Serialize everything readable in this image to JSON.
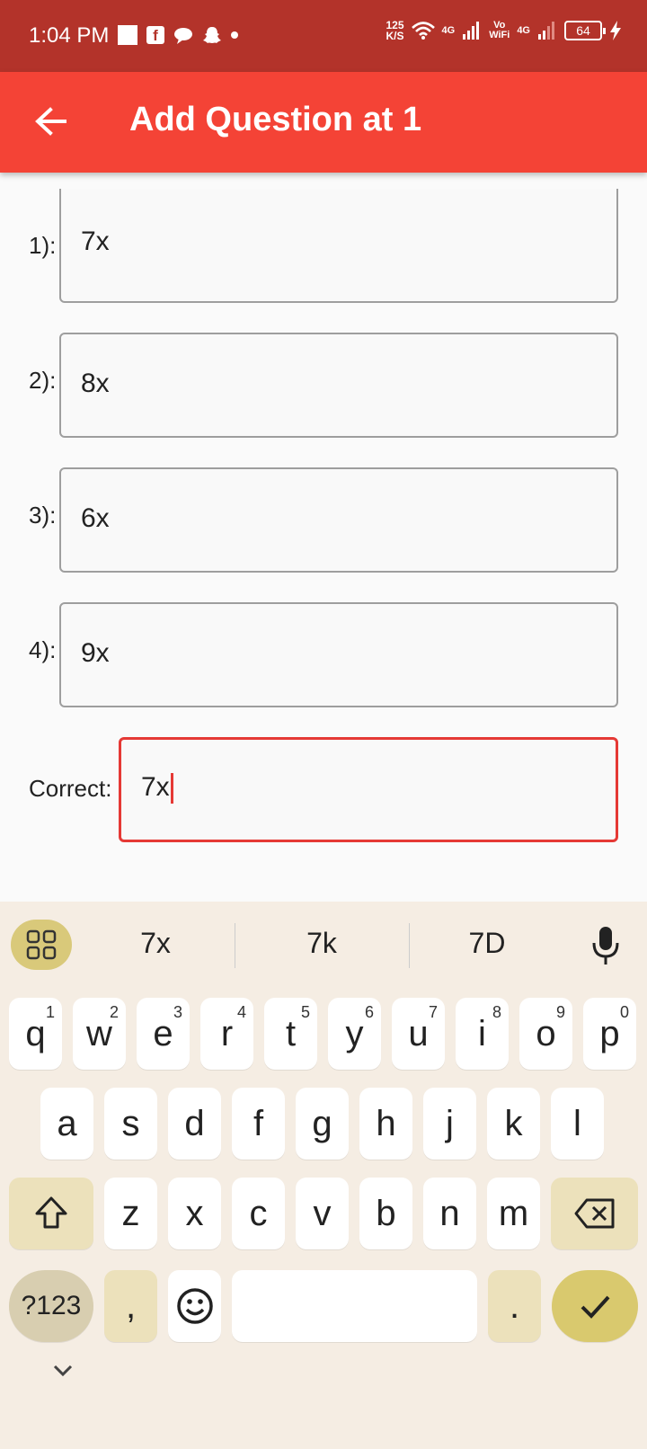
{
  "status_bar": {
    "time": "1:04 PM",
    "speed_value": "125",
    "speed_unit": "K/S",
    "network1": "4G",
    "volte_top": "Vo",
    "volte_bottom": "WiFi",
    "network2": "4G",
    "battery": "64"
  },
  "app_bar": {
    "title": "Add Question at 1"
  },
  "options": [
    {
      "label": "1):",
      "value": "7x"
    },
    {
      "label": "2):",
      "value": "8x"
    },
    {
      "label": "3):",
      "value": "6x"
    },
    {
      "label": "4):",
      "value": "9x"
    }
  ],
  "correct": {
    "label": "Correct:",
    "value": "7x"
  },
  "keyboard": {
    "suggestions": [
      "7x",
      "7k",
      "7D"
    ],
    "row1": [
      {
        "key": "q",
        "hint": "1"
      },
      {
        "key": "w",
        "hint": "2"
      },
      {
        "key": "e",
        "hint": "3"
      },
      {
        "key": "r",
        "hint": "4"
      },
      {
        "key": "t",
        "hint": "5"
      },
      {
        "key": "y",
        "hint": "6"
      },
      {
        "key": "u",
        "hint": "7"
      },
      {
        "key": "i",
        "hint": "8"
      },
      {
        "key": "o",
        "hint": "9"
      },
      {
        "key": "p",
        "hint": "0"
      }
    ],
    "row2": [
      "a",
      "s",
      "d",
      "f",
      "g",
      "h",
      "j",
      "k",
      "l"
    ],
    "row3": [
      "z",
      "x",
      "c",
      "v",
      "b",
      "n",
      "m"
    ],
    "symbols_label": "?123",
    "comma": ",",
    "period": "."
  },
  "colors": {
    "status_bar": "#b3332a",
    "app_bar": "#f44336",
    "focus_border": "#e53935",
    "keyboard_bg": "#f5ede3"
  }
}
